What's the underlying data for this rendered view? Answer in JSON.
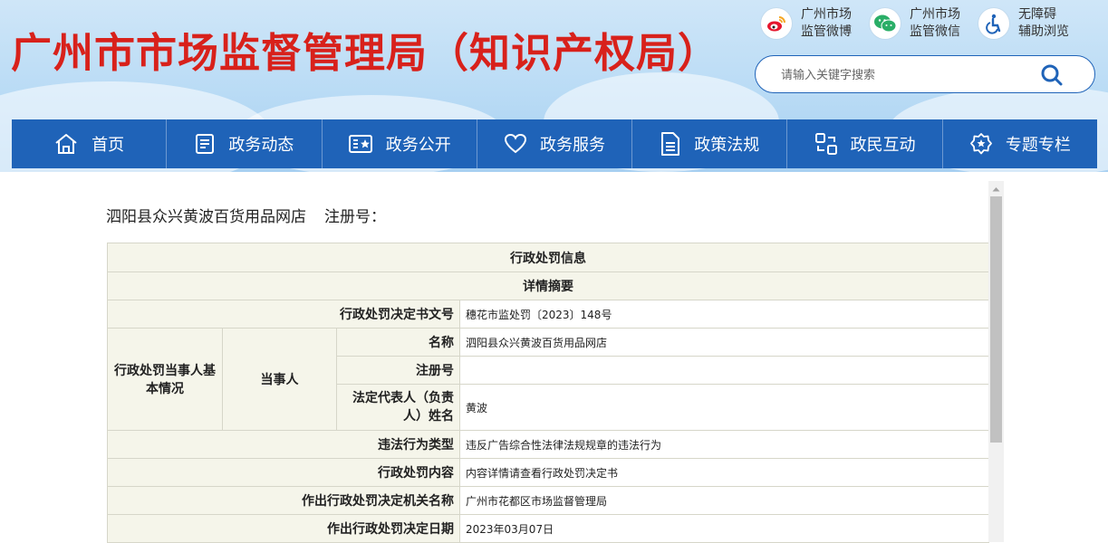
{
  "header": {
    "site_title": "广州市市场监督管理局（知识产权局）",
    "links": [
      {
        "icon": "weibo-icon",
        "line1": "广州市场",
        "line2": "监管微博"
      },
      {
        "icon": "wechat-icon",
        "line1": "广州市场",
        "line2": "监管微信"
      },
      {
        "icon": "accessibility-icon",
        "line1": "无障碍",
        "line2": "辅助浏览"
      }
    ],
    "search": {
      "placeholder": "请输入关键字搜索",
      "value": ""
    },
    "colors": {
      "title": "#d8211b",
      "nav": "#1f63b8"
    }
  },
  "nav": [
    {
      "label": "首页",
      "icon": "home-icon"
    },
    {
      "label": "政务动态",
      "icon": "news-icon"
    },
    {
      "label": "政务公开",
      "icon": "public-info-icon"
    },
    {
      "label": "政务服务",
      "icon": "heart-icon"
    },
    {
      "label": "政策法规",
      "icon": "document-icon"
    },
    {
      "label": "政民互动",
      "icon": "interaction-icon"
    },
    {
      "label": "专题专栏",
      "icon": "badge-icon"
    }
  ],
  "company": {
    "name": "泗阳县众兴黄波百货用品网店",
    "reg_label": "注册号："
  },
  "table": {
    "title": "行政处罚信息",
    "subtitle": "详情摘要",
    "decision_no_label": "行政处罚决定书文号",
    "decision_no": "穗花市监处罚〔2023〕148号",
    "party_group_label": "行政处罚当事人基本情况",
    "party_label": "当事人",
    "name_label": "名称",
    "name_value": "泗阳县众兴黄波百货用品网店",
    "reg_label": "注册号",
    "reg_value": "",
    "legal_rep_label": "法定代表人（负责人）姓名",
    "legal_rep_value": "黄波",
    "violation_type_label": "违法行为类型",
    "violation_type_value": "违反广告综合性法律法规规章的违法行为",
    "penalty_content_label": "行政处罚内容",
    "penalty_content_value": "内容详情请查看行政处罚决定书",
    "authority_label": "作出行政处罚决定机关名称",
    "authority_value": "广州市花都区市场监督管理局",
    "date_label": "作出行政处罚决定日期",
    "date_value": "2023年03月07日"
  }
}
